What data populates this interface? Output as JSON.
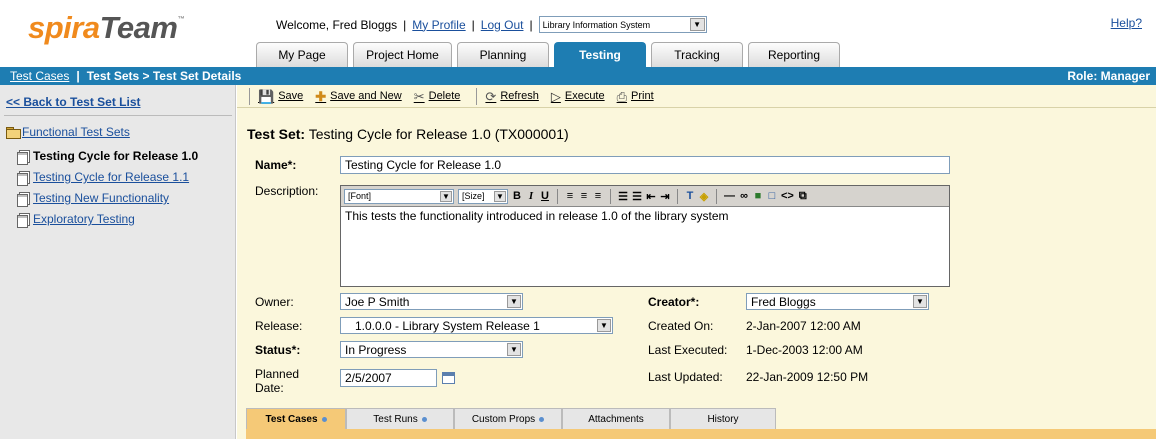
{
  "app": {
    "logo_part1": "spira",
    "logo_part2": "Team",
    "logo_tm": "™"
  },
  "header": {
    "welcome": "Welcome, Fred Bloggs",
    "my_profile": "My Profile",
    "log_out": "Log Out",
    "project_selected": "Library Information System",
    "help": "Help?"
  },
  "tabs": [
    {
      "label": "My Page"
    },
    {
      "label": "Project Home"
    },
    {
      "label": "Planning"
    },
    {
      "label": "Testing",
      "active": true
    },
    {
      "label": "Tracking"
    },
    {
      "label": "Reporting"
    }
  ],
  "navbar": {
    "test_cases": "Test Cases",
    "separator": "|",
    "breadcrumb": "Test Sets > Test Set Details",
    "role": "Role: Manager"
  },
  "sidebar": {
    "back": "<< Back to Test Set List",
    "root": "Functional Test Sets",
    "items": [
      {
        "label": "Testing Cycle for Release 1.0",
        "current": true
      },
      {
        "label": "Testing Cycle for Release 1.1"
      },
      {
        "label": "Testing New Functionality"
      },
      {
        "label": "Exploratory Testing"
      }
    ]
  },
  "toolbar": {
    "save": "Save",
    "save_and_new": "Save and New",
    "delete": "Delete",
    "refresh": "Refresh",
    "execute": "Execute",
    "print": "Print"
  },
  "form": {
    "heading_label": "Test Set:",
    "heading_value": "Testing Cycle for Release 1.0 (TX000001)",
    "name_label": "Name*:",
    "name_value": "Testing Cycle for Release 1.0",
    "description_label": "Description:",
    "editor_font": "[Font]",
    "editor_size": "[Size]",
    "description_value": "This tests the functionality introduced in release 1.0 of the library system",
    "owner_label": "Owner:",
    "owner_value": "Joe P Smith",
    "release_label": "Release:",
    "release_value": "1.0.0.0 - Library System Release 1",
    "status_label": "Status*:",
    "status_value": "In Progress",
    "planned_label_1": "Planned",
    "planned_label_2": "Date:",
    "planned_value": "2/5/2007",
    "creator_label": "Creator*:",
    "creator_value": "Fred Bloggs",
    "created_on_label": "Created On:",
    "created_on_value": "2-Jan-2007 12:00 AM",
    "last_executed_label": "Last Executed:",
    "last_executed_value": "1-Dec-2003 12:00 AM",
    "last_updated_label": "Last Updated:",
    "last_updated_value": "22-Jan-2009 12:50 PM"
  },
  "bottom_tabs": [
    {
      "label": "Test Cases",
      "active": true,
      "dot": true
    },
    {
      "label": "Test Runs",
      "dot": true
    },
    {
      "label": "Custom Props",
      "dot": true
    },
    {
      "label": "Attachments",
      "dot": false
    },
    {
      "label": "History",
      "dot": false
    }
  ],
  "colors": {
    "accent": "#1e7db2",
    "main_bg": "#fbf7dc",
    "tab_active": "#f5c977",
    "logo_orange": "#f08a1d"
  }
}
